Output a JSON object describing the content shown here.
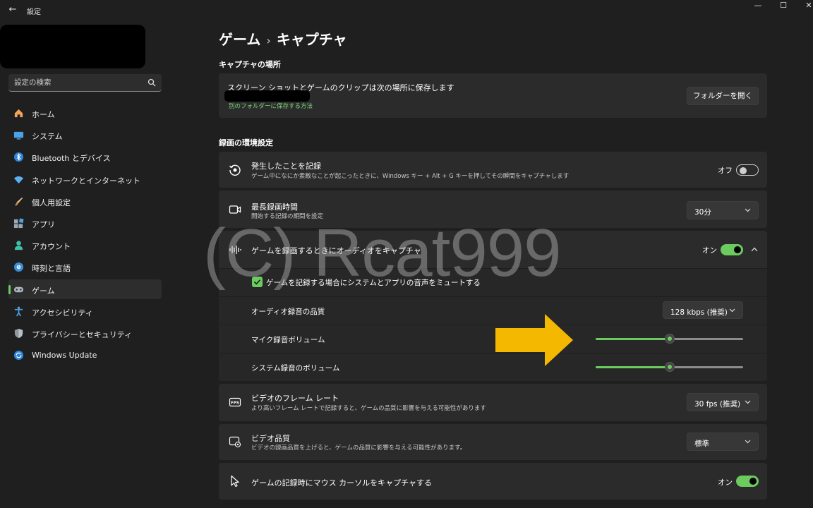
{
  "window": {
    "title": "設定",
    "back_glyph": "←",
    "min_glyph": "—",
    "max_glyph": "☐",
    "close_glyph": "✕"
  },
  "sidebar": {
    "search_placeholder": "設定の検索",
    "items": [
      {
        "label": "ホーム",
        "icon": "home-icon"
      },
      {
        "label": "システム",
        "icon": "system-icon"
      },
      {
        "label": "Bluetooth とデバイス",
        "icon": "bluetooth-icon"
      },
      {
        "label": "ネットワークとインターネット",
        "icon": "wifi-icon"
      },
      {
        "label": "個人用設定",
        "icon": "brush-icon"
      },
      {
        "label": "アプリ",
        "icon": "apps-icon"
      },
      {
        "label": "アカウント",
        "icon": "account-icon"
      },
      {
        "label": "時刻と言語",
        "icon": "globe-icon"
      },
      {
        "label": "ゲーム",
        "icon": "gamepad-icon",
        "active": true
      },
      {
        "label": "アクセシビリティ",
        "icon": "accessibility-icon"
      },
      {
        "label": "プライバシーとセキュリティ",
        "icon": "shield-icon"
      },
      {
        "label": "Windows Update",
        "icon": "update-icon"
      }
    ]
  },
  "breadcrumb": {
    "parent": "ゲーム",
    "separator": "›",
    "current": "キャプチャ"
  },
  "capture_location": {
    "heading": "キャプチャの場所",
    "title": "スクリーン ショットとゲームのクリップは次の場所に保存します",
    "link": "別のフォルダーに保存する方法",
    "button": "フォルダーを開く"
  },
  "recording": {
    "heading": "録画の環境設定",
    "record_what_happened": {
      "title": "発生したことを記録",
      "subtitle": "ゲーム中になにか素敵なことが起こったときに、Windows キー + Alt + G キーを押してその瞬間をキャプチャします",
      "state_label": "オフ",
      "on": false
    },
    "max_duration": {
      "title": "最長録画時間",
      "subtitle": "開始する記録の期間を設定",
      "value": "30分"
    },
    "audio_capture": {
      "title": "ゲームを録画するときにオーディオをキャプチャ",
      "state_label": "オン",
      "on": true,
      "mute_option": {
        "label": "ゲームを記録する場合にシステムとアプリの音声をミュートする",
        "checked": true
      },
      "audio_quality": {
        "label": "オーディオ録音の品質",
        "value": "128 kbps (推奨)"
      },
      "mic_volume": {
        "label": "マイク録音ボリューム",
        "level": 0.5
      },
      "system_volume": {
        "label": "システム録音のボリューム",
        "level": 0.5
      }
    },
    "frame_rate": {
      "title": "ビデオのフレーム レート",
      "subtitle": "より高いフレーム レートで記録すると、ゲームの品質に影響を与える可能性があります",
      "value": "30 fps (推奨)"
    },
    "video_quality": {
      "title": "ビデオ品質",
      "subtitle": "ビデオの録画品質を上げると、ゲームの品質に影響を与える可能性があります。",
      "value": "標準"
    },
    "mouse_cursor": {
      "title": "ゲームの記録時にマウス カーソルをキャプチャする",
      "state_label": "オン",
      "on": true
    }
  },
  "watermark": "(C) Rcat999",
  "colors": {
    "accent": "#6ccb5f",
    "background": "#1f1f1f",
    "card": "#2b2b2b",
    "arrow": "#f5b800"
  }
}
